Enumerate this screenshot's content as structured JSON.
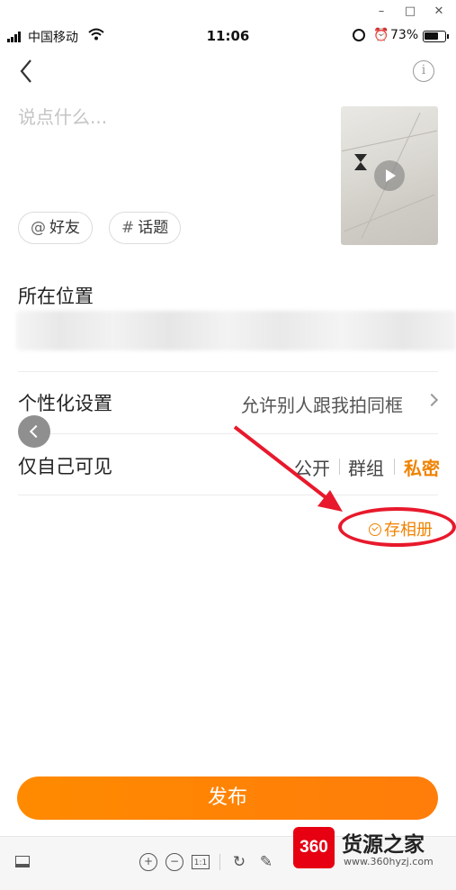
{
  "window_controls": {
    "minimize": "–",
    "maximize": "□",
    "close": "✕"
  },
  "status_bar": {
    "carrier": "中国移动",
    "time": "11:06",
    "battery": "73%",
    "battery_level": 0.73
  },
  "header": {
    "info_label": "i"
  },
  "compose": {
    "placeholder": "说点什么..."
  },
  "tags": [
    {
      "symbol": "@",
      "label": "好友"
    },
    {
      "symbol": "#",
      "label": "话题"
    }
  ],
  "location": {
    "label": "所在位置"
  },
  "personalization": {
    "label": "个性化设置",
    "value": "允许别人跟我拍同框"
  },
  "visibility": {
    "label": "仅自己可见",
    "options": [
      "公开",
      "群组",
      "私密"
    ],
    "selected": "私密"
  },
  "save_album": {
    "label": "存相册"
  },
  "publish": {
    "label": "发布"
  },
  "toolbar": {
    "zoom_in": "+",
    "zoom_out": "−",
    "actual_size": "1:1",
    "rotate": "↻",
    "edit": "✎"
  },
  "watermark": {
    "logo": "360",
    "brand": "货源之家",
    "url": "www.360hyzj.com"
  },
  "colors": {
    "accent": "#f08200",
    "publish": "#ff8a00",
    "annotation": "#e8192c"
  }
}
